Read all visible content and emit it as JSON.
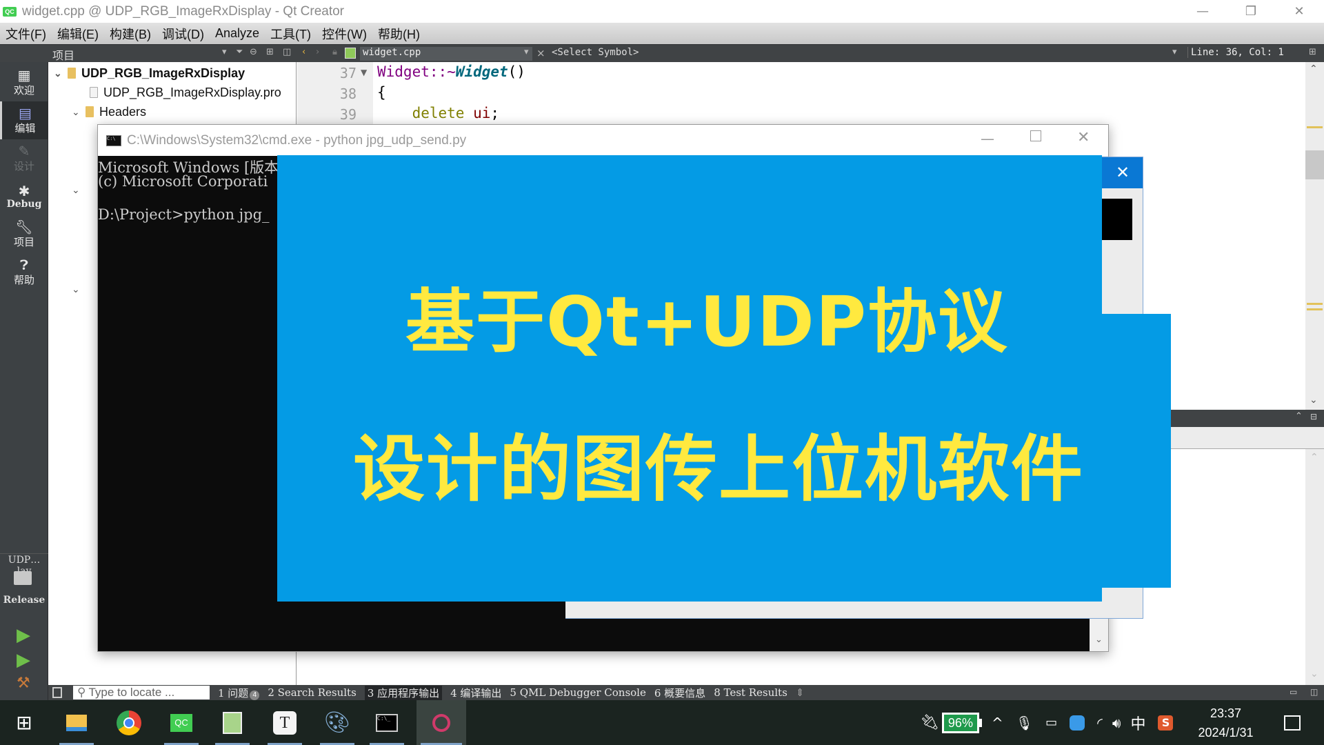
{
  "window": {
    "app_icon": "QC",
    "title": "widget.cpp @ UDP_RGB_ImageRxDisplay - Qt Creator",
    "controls": {
      "minimize": "—",
      "restore": "❐",
      "close": "✕"
    }
  },
  "menu": [
    "文件(F)",
    "编辑(E)",
    "构建(B)",
    "调试(D)",
    "Analyze",
    "工具(T)",
    "控件(W)",
    "帮助(H)"
  ],
  "toolstrip": {
    "project_label": "项目",
    "file_tab": "widget.cpp",
    "symbol": "<Select Symbol>",
    "cursor": "Line: 36, Col: 1"
  },
  "modes": [
    {
      "label": "欢迎",
      "icon": "grid-icon"
    },
    {
      "label": "编辑",
      "icon": "edit-icon",
      "active": true
    },
    {
      "label": "设计",
      "icon": "pencil-icon",
      "disabled": true
    },
    {
      "label": "Debug",
      "icon": "bug-icon"
    },
    {
      "label": "项目",
      "icon": "wrench-icon"
    },
    {
      "label": "帮助",
      "icon": "help-icon"
    }
  ],
  "kit": {
    "project": "UDP…lay",
    "build": "Release"
  },
  "tree": {
    "root": "UDP_RGB_ImageRxDisplay",
    "items": [
      "UDP_RGB_ImageRxDisplay.pro",
      "Headers"
    ]
  },
  "editor": {
    "lines": [
      {
        "num": "37",
        "code_a": "Widget::~",
        "code_b": "Widget",
        "code_c": "()"
      },
      {
        "num": "38",
        "code": "{"
      },
      {
        "num": "39",
        "code_kw": "delete",
        "code_var": "ui",
        "code_end": ";"
      }
    ]
  },
  "cmd": {
    "title": "C:\\Windows\\System32\\cmd.exe - python  jpg_udp_send.py",
    "lines": [
      "Microsoft Windows [版本",
      "(c) Microsoft Corporati",
      "",
      "D:\\Project>python jpg_"
    ]
  },
  "banner": {
    "line1": "基于Qt+UDP协议",
    "line2": "设计的图传上位机软件",
    "bg_color": "#049be5",
    "text_color": "#ffe93f"
  },
  "bottom_panel": {
    "locate_placeholder": "Type to locate ...",
    "tabs": [
      {
        "label": "1 问题",
        "badge": "4"
      },
      {
        "label": "2 Search Results"
      },
      {
        "label": "3 应用程序输出",
        "active": true
      },
      {
        "label": "4 编译输出"
      },
      {
        "label": "5 QML Debugger Console"
      },
      {
        "label": "6 概要信息"
      },
      {
        "label": "8 Test Results"
      }
    ]
  },
  "taskbar": {
    "apps": [
      "windows-start",
      "file-explorer",
      "chrome",
      "qt-creator",
      "notepad-plus-plus",
      "typora",
      "paint",
      "cmd",
      "camera-app"
    ],
    "battery": "96%",
    "ime": "中",
    "time": "23:37",
    "date": "2024/1/31"
  }
}
